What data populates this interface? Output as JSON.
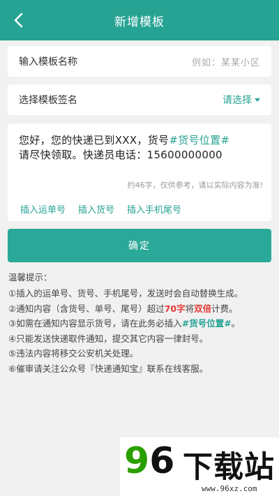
{
  "header": {
    "title": "新增模板"
  },
  "name_row": {
    "label": "输入模板名称",
    "placeholder": "例如：某某小区"
  },
  "sign_row": {
    "label": "选择模板签名",
    "select": "请选择"
  },
  "content": {
    "line1_a": "您好，您的快递已到XXX，货号",
    "line1_b": "#货号位置#",
    "line2": "请尽快领取。快递员电话：15600000000",
    "hint": "约46字，仅供参考，请以实际内容为准!"
  },
  "actions": [
    "插入运单号",
    "插入货号",
    "插入手机尾号"
  ],
  "confirm": "确定",
  "tips": {
    "title": "温馨提示：",
    "t1": "①插入的运单号、货号、手机尾号，发送时会自动替换生成。",
    "t2_a": "②通知内容（含货号、单号、尾号）超过",
    "t2_b": "70字",
    "t2_c": "将",
    "t2_d": "双倍",
    "t2_e": "计费。",
    "t3_a": "③如需在通知内容显示货号，请在此务必插入",
    "t3_b": "#货号位置#",
    "t3_c": "。",
    "t4": "④只能发送快递取件通知，提交其它内容一律封号。",
    "t5": "⑤违法内容将移交公安机关处理。",
    "t6": "⑥催审请关注公众号『快递通知宝』联系在线客服。"
  },
  "watermark": {
    "nine": "9",
    "six": "6",
    "cn": "下载站",
    "url": "www.96xz.com"
  },
  "colors": {
    "accent": "#27a393",
    "warning": "#e53935"
  }
}
